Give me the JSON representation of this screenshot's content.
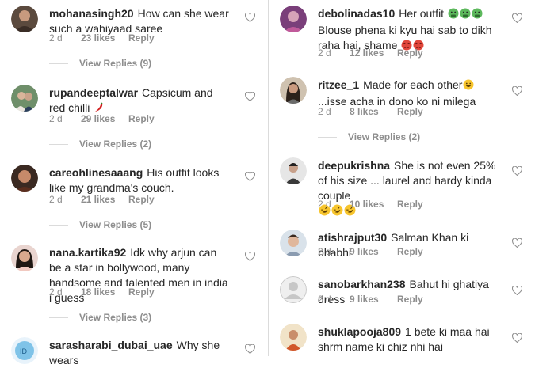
{
  "left": {
    "c1": {
      "username": "mohanasingh20",
      "text": "How can she wear such a wahiyaad saree",
      "time": "2 d",
      "likes": "23 likes",
      "reply": "Reply",
      "replies": "View Replies (9)"
    },
    "c2": {
      "username": "rupandeeptalwar",
      "text": "Capsicum and red chilli",
      "time": "2 d",
      "likes": "29 likes",
      "reply": "Reply",
      "replies": "View Replies (2)"
    },
    "c3": {
      "username": "careohlinesaaang",
      "text": "His outfit looks like my grandma's couch.",
      "time": "2 d",
      "likes": "21 likes",
      "reply": "Reply",
      "replies": "View Replies (5)"
    },
    "c4": {
      "username": "nana.kartika92",
      "text": "Idk why arjun can be a star in bollywood, many handsome and talented men in india i guess",
      "time": "2 d",
      "likes": "18 likes",
      "reply": "Reply",
      "replies": "View Replies (3)"
    },
    "c5": {
      "username": "sarasharabi_dubai_uae",
      "text": "Why she wears"
    }
  },
  "right": {
    "c1": {
      "username": "debolinadas10",
      "text": "Her outfit",
      "text2": "Blouse phena ki kyu hai sab to dikh raha hai, shame",
      "time": "2 d",
      "likes": "12 likes",
      "reply": "Reply"
    },
    "c2": {
      "username": "ritzee_1",
      "text": "Made for each other",
      "text2": "...isse acha in dono ko  ni milega",
      "time": "2 d",
      "likes": "8 likes",
      "reply": "Reply",
      "replies": "View Replies (2)"
    },
    "c3": {
      "username": "deepukrishna",
      "text": "She is not even 25% of his size ... laurel and hardy kinda couple",
      "time": "2 d",
      "likes": "10 likes",
      "reply": "Reply"
    },
    "c4": {
      "username": "atishrajput30",
      "text": "Salman Khan ki bhabhi",
      "time": "2 d",
      "likes": "9 likes",
      "reply": "Reply"
    },
    "c5": {
      "username": "sanobarkhan238",
      "text": "Bahut hi ghatiya dress",
      "time": "2 d",
      "likes": "9 likes",
      "reply": "Reply"
    },
    "c6": {
      "username": "shuklapooja809",
      "text": "1 bete ki maa hai shrm name ki chiz nhi hai"
    }
  },
  "icons": {
    "heart": "heart-outline-icon",
    "emoji_sick": "face-vomiting-emoji",
    "emoji_angry": "face-pouting-emoji",
    "emoji_grin": "face-grinning-sweat-emoji",
    "emoji_laugh": "face-rolling-laughing-emoji",
    "emoji_chilli": "hot-pepper-emoji"
  },
  "colors": {
    "text": "#262626",
    "meta": "#8e8e8e",
    "divider": "#dbdbdb"
  }
}
